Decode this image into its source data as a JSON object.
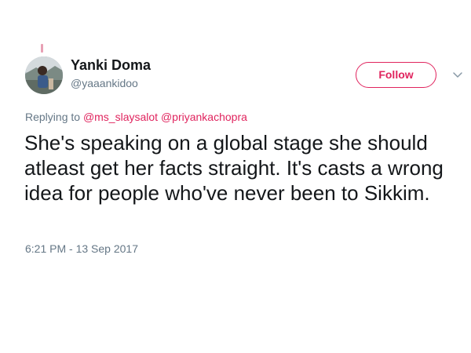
{
  "tweet": {
    "author": {
      "display_name": "Yanki Doma",
      "handle": "@yaaankidoo",
      "avatar_icon": "user-avatar-photo"
    },
    "follow_label": "Follow",
    "more_options_icon": "chevron-down-icon",
    "reply_prefix": "Replying to",
    "mentions": [
      "@ms_slaysalot",
      "@priyankachopra"
    ],
    "text": "She's speaking on a global stage she should atleast get her facts straight. It's casts a wrong idea for people who've never been to Sikkim.",
    "timestamp": "6:21 PM - 13 Sep 2017"
  },
  "colors": {
    "accent": "#e0245e",
    "text_primary": "#14171a",
    "text_secondary": "#657786",
    "background": "#ffffff"
  }
}
